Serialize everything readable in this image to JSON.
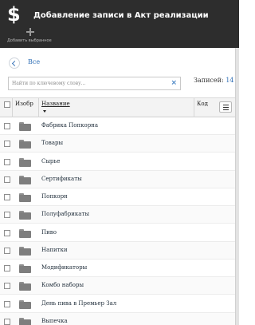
{
  "header": {
    "app_icon": "dollar-icon",
    "app_symbol": "$",
    "title": "Добавление записи в Акт реализации",
    "add_selected_label": "Добавить выбранное"
  },
  "nav": {
    "all_label": "Все"
  },
  "search": {
    "placeholder": "Найти по ключевому слову...",
    "value": "",
    "clear_glyph": "×"
  },
  "records": {
    "label": "Записей:",
    "count": "14"
  },
  "table": {
    "columns": [
      "Изобр",
      "Название",
      "Код"
    ],
    "sort_column": "Название",
    "rows": [
      {
        "name": "Фабрика Попкорна",
        "icon": "folder-icon"
      },
      {
        "name": "Товары",
        "icon": "folder-icon"
      },
      {
        "name": "Сырье",
        "icon": "folder-icon"
      },
      {
        "name": "Сертификаты",
        "icon": "folder-icon"
      },
      {
        "name": "Попкорн",
        "icon": "folder-icon"
      },
      {
        "name": "Полуфабрикаты",
        "icon": "folder-icon"
      },
      {
        "name": "Пиво",
        "icon": "folder-icon"
      },
      {
        "name": "Напитки",
        "icon": "folder-icon"
      },
      {
        "name": "Модификаторы",
        "icon": "folder-icon"
      },
      {
        "name": "Комбо наборы",
        "icon": "folder-icon"
      },
      {
        "name": "День пива в Премьер Зал",
        "icon": "folder-icon"
      },
      {
        "name": "Выпечка",
        "icon": "folder-icon"
      }
    ]
  },
  "colors": {
    "header_bg": "#2d2d2d",
    "link": "#2f6fb6",
    "folder": "#7e7e7e"
  }
}
